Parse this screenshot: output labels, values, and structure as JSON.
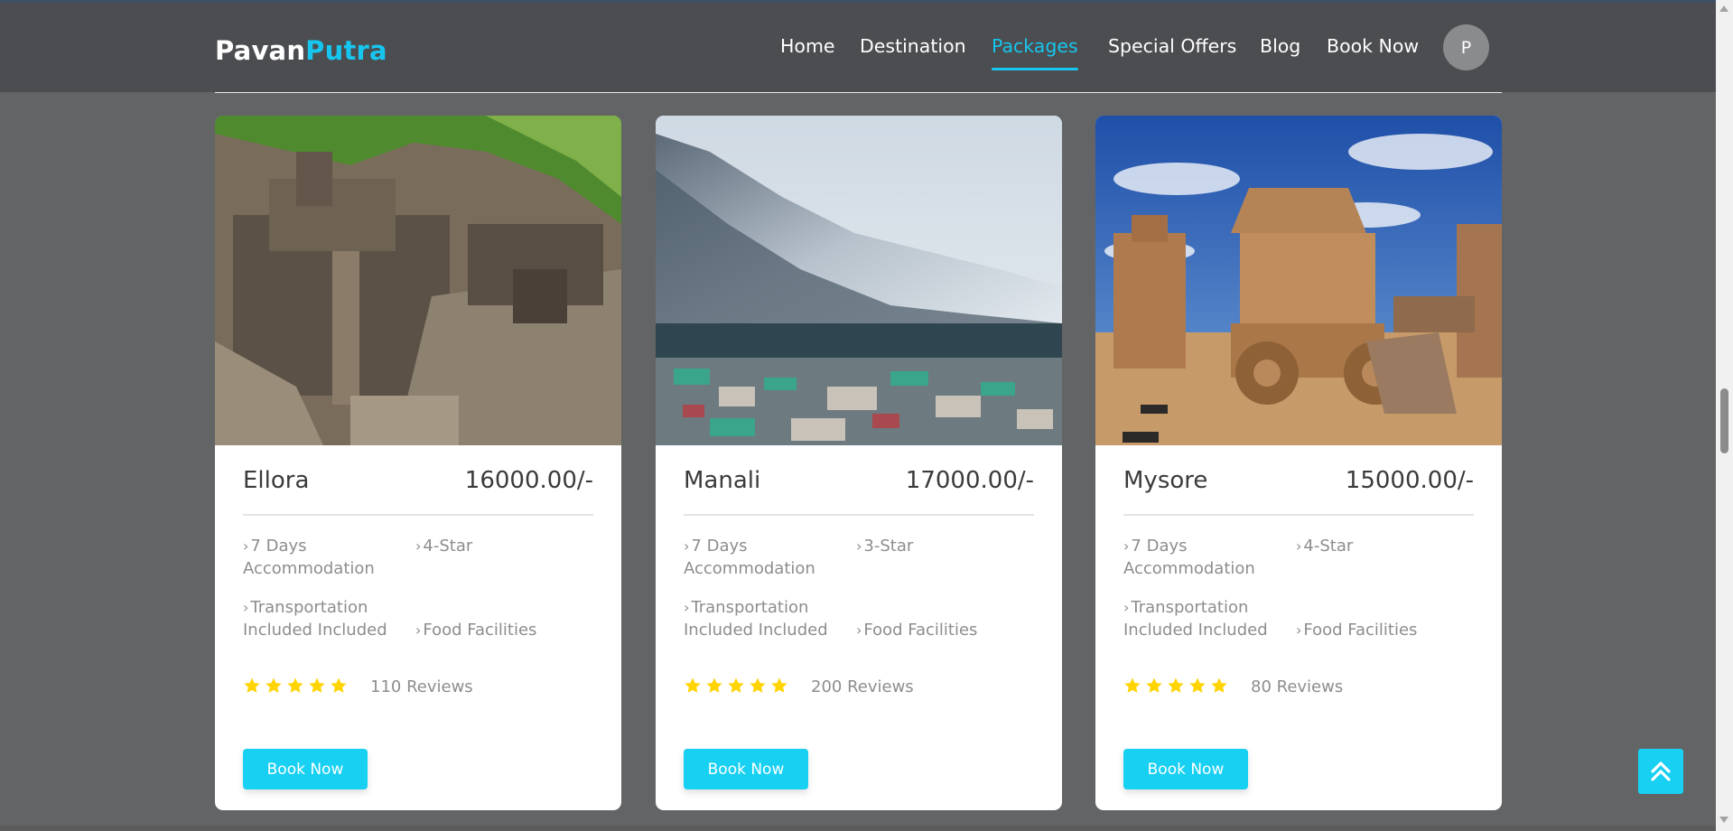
{
  "brand": {
    "part1": "Pavan",
    "part2": "Putra"
  },
  "nav": {
    "items": [
      {
        "label": "Home",
        "active": false
      },
      {
        "label": "Destination",
        "active": false
      },
      {
        "label": "Packages",
        "active": true
      },
      {
        "label": "Special Offers",
        "active": false
      },
      {
        "label": "Blog",
        "active": false
      },
      {
        "label": "Book Now",
        "active": false
      }
    ],
    "avatar_initial": "P"
  },
  "packages": [
    {
      "name": "Ellora",
      "price": "16000.00/-",
      "features": [
        "7 Days Accommodation",
        "4-Star",
        "Transportation Included Included",
        "Food Facilities"
      ],
      "rating": 5,
      "reviews": "110 Reviews",
      "button": "Book Now",
      "image": "ellora-caves-photo"
    },
    {
      "name": "Manali",
      "price": "17000.00/-",
      "features": [
        "7 Days Accommodation",
        "3-Star",
        "Transportation Included Included",
        "Food Facilities"
      ],
      "rating": 5,
      "reviews": "200 Reviews",
      "button": "Book Now",
      "image": "manali-mountains-photo"
    },
    {
      "name": "Mysore",
      "price": "15000.00/-",
      "features": [
        "7 Days Accommodation",
        "4-Star",
        "Transportation Included Included",
        "Food Facilities"
      ],
      "rating": 5,
      "reviews": "80 Reviews",
      "button": "Book Now",
      "image": "stone-chariot-photo"
    }
  ],
  "colors": {
    "accent": "#16c6ee",
    "header": "#4c4d50",
    "background": "#636465",
    "star": "#ffd400"
  },
  "scroll_top_icon": "double-chevron-up-icon"
}
